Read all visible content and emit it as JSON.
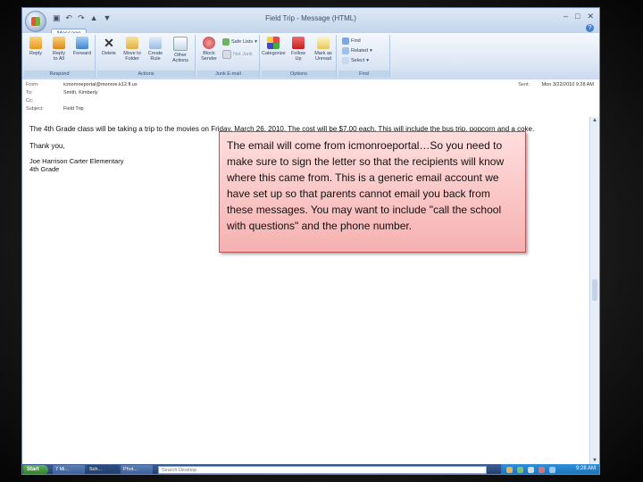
{
  "window": {
    "title": "Field Trip - Message (HTML)",
    "tab": "Message",
    "help": "?"
  },
  "ribbon": {
    "respond": {
      "label": "Respond",
      "reply": "Reply",
      "reply_all": "Reply\nto All",
      "forward": "Forward"
    },
    "actions": {
      "label": "Actions",
      "delete": "Delete",
      "move_to_folder": "Move to\nFolder",
      "create_rule": "Create\nRule",
      "other_actions": "Other\nActions"
    },
    "junk": {
      "label": "Junk E-mail",
      "block_sender": "Block\nSender",
      "safe_lists": "Safe Lists",
      "not_junk": "Not Junk"
    },
    "options": {
      "label": "Options",
      "categorize": "Categorize",
      "follow_up": "Follow\nUp",
      "mark_unread": "Mark as\nUnread"
    },
    "find": {
      "label": "Find",
      "find": "Find",
      "related": "Related",
      "select": "Select"
    }
  },
  "header": {
    "from_label": "From:",
    "from_value": "icmonroeportal@monroe.k12.fl.us",
    "to_label": "To:",
    "to_value": "Smith, Kimberly",
    "cc_label": "Cc:",
    "cc_value": "",
    "subject_label": "Subject:",
    "subject_value": "Field Trip",
    "sent_label": "Sent:",
    "sent_value": "Mon 3/22/2010 9:28 AM"
  },
  "body": {
    "line1": "The 4th Grade class will be taking a trip to the movies on Friday, March 26, 2010. The cost will be $7.00 each. This will include the bus trip, popcorn and a coke.",
    "thanks": "Thank you,",
    "sig_name": "Joe Harrison Carter Elementary",
    "sig_grade": "4th Grade"
  },
  "callout": {
    "text": "The email will come from icmonroeportal…So you need to make sure to sign the letter so that the recipients will know where this came from.  This is a generic email account we have set up so that parents cannot email you back from these messages. You may want to include \"call the school with questions\" and the phone number."
  },
  "taskbar": {
    "start": "Start",
    "btn1": "7 Mi...",
    "btn2": "Sch...",
    "btn3": "Phot...",
    "search_placeholder": "Search Desktop",
    "clock": "9:28 AM"
  },
  "colors": {
    "ribbon_bg": "#dbe6f4",
    "callout_bg": "#f6b1b1",
    "taskbar_bg": "#1e3a6b"
  }
}
